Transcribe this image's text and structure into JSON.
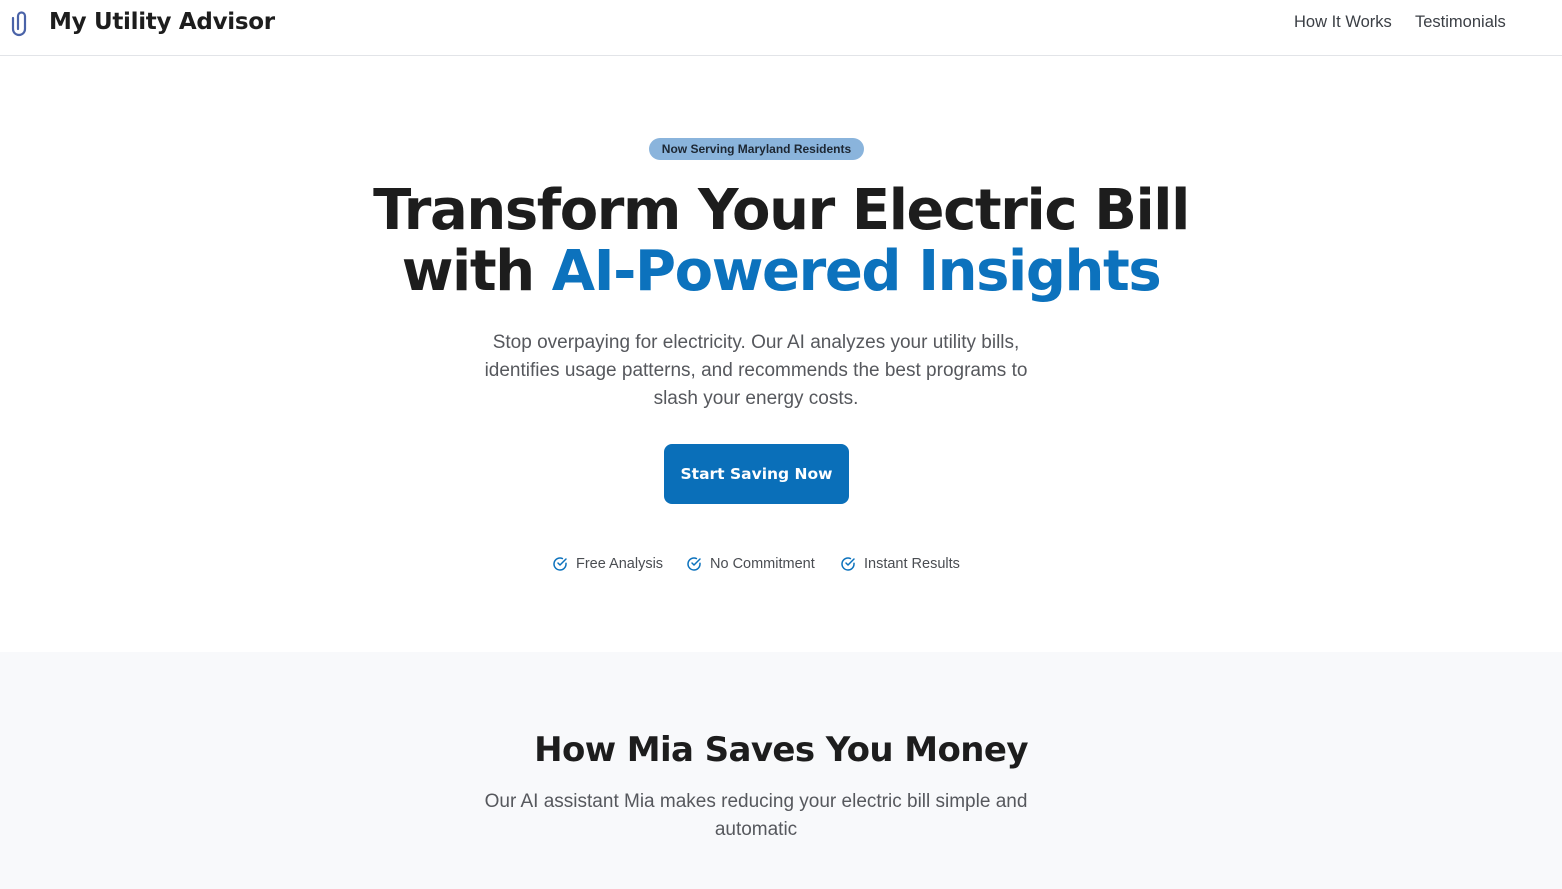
{
  "nav": {
    "brand": "My Utility Advisor",
    "links": [
      "How It Works",
      "Testimonials"
    ]
  },
  "hero": {
    "badge": "Now Serving Maryland Residents",
    "headline_plain": "Transform Your Electric Bill with ",
    "headline_accent": "AI-Powered Insights",
    "subtext": "Stop overpaying for electricity. Our AI analyzes your utility bills, identifies usage patterns, and recommends the best programs to slash your energy costs.",
    "cta": "Start Saving Now",
    "features": [
      "Free Analysis",
      "No Commitment",
      "Instant Results"
    ]
  },
  "how": {
    "title": "How Mia Saves You Money",
    "subtitle": "Our AI assistant Mia makes reducing your electric bill simple and automatic"
  },
  "icons": {
    "logo": "paperclip-icon",
    "feature_check": "check-circle-icon"
  },
  "colors": {
    "accent": "#0c72bd",
    "button": "#0a6fb9",
    "badge_bg": "#8ab4dc",
    "section_bg": "#f8f9fb"
  }
}
